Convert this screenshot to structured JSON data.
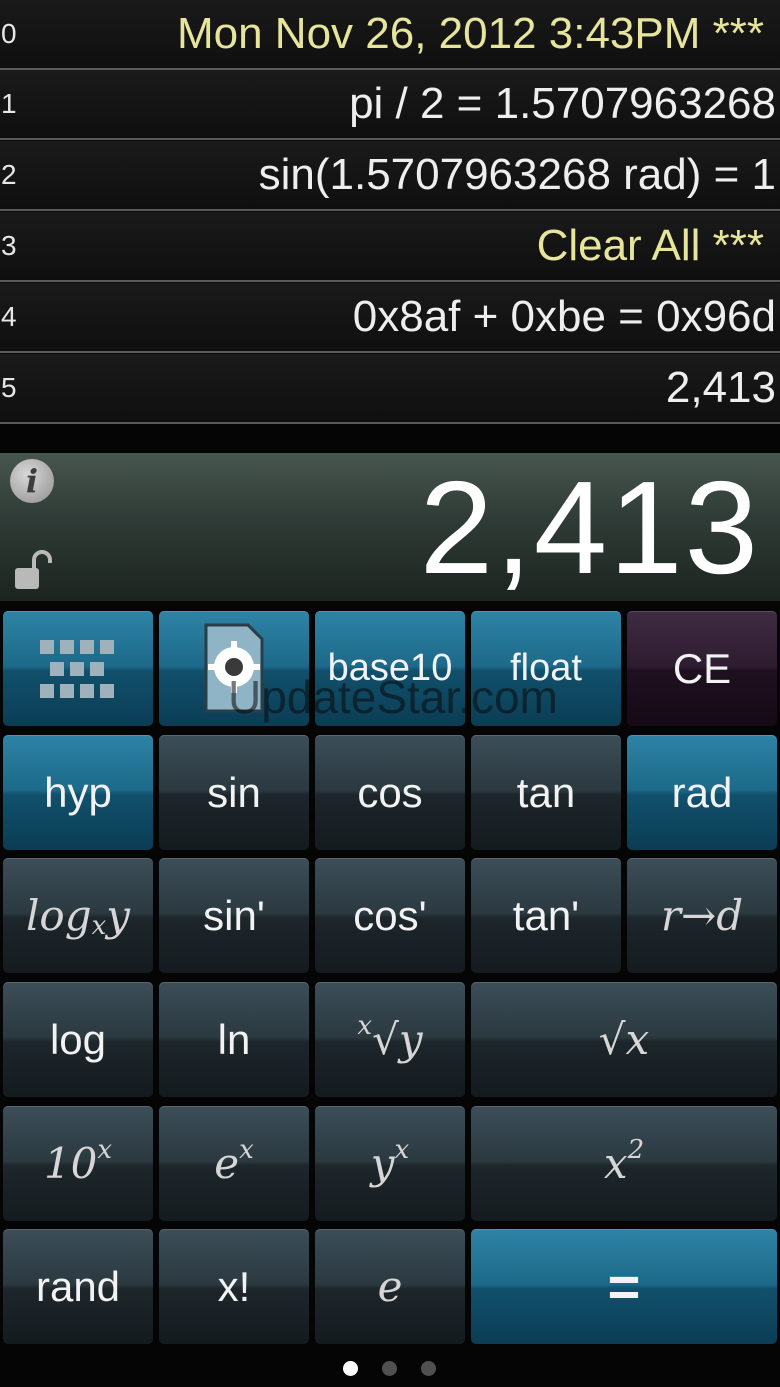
{
  "tape": [
    {
      "index": "0",
      "text": "Mon Nov 26, 2012 3:43PM ***",
      "style": "yellow"
    },
    {
      "index": "1",
      "text": "pi / 2 = 1.5707963268",
      "style": "white"
    },
    {
      "index": "2",
      "text": "sin(1.5707963268 rad) = 1",
      "style": "white"
    },
    {
      "index": "3",
      "text": "Clear All ***",
      "style": "yellow"
    },
    {
      "index": "4",
      "text": "0x8af + 0xbe = 0x96d",
      "style": "white"
    },
    {
      "index": "5",
      "text": "2,413",
      "style": "white"
    }
  ],
  "display": {
    "value": "2,413",
    "info_icon": "info-icon",
    "lock_icon": "unlock-icon"
  },
  "keys": {
    "row1": {
      "grid_icon": "grid-icon",
      "settings_icon": "gear-document-icon",
      "base": "base10",
      "mode": "float",
      "ce": "CE"
    },
    "row2": {
      "hyp": "hyp",
      "sin": "sin",
      "cos": "cos",
      "tan": "tan",
      "rad": "rad"
    },
    "row3": {
      "log_base": "log",
      "log_x": "x",
      "log_y": "y",
      "asin": "sin'",
      "acos": "cos'",
      "atan": "tan'",
      "r2d": "r→d"
    },
    "row4": {
      "log": "log",
      "ln": "ln",
      "root_x": "x",
      "root_y": "y",
      "sqrt": "√x"
    },
    "row5": {
      "ten_base": "10",
      "ten_exp": "x",
      "e_base": "e",
      "e_exp": "x",
      "y_base": "y",
      "y_exp": "x",
      "sq_base": "x",
      "sq_exp": "2"
    },
    "row6": {
      "rand": "rand",
      "fact": "x!",
      "e": "e",
      "equals": "="
    }
  },
  "watermark": "UpdateStar.com",
  "pager": {
    "count": 3,
    "active": 1
  },
  "colors": {
    "tape_yellow": "#e7e49c",
    "blue_key": "#1d6989",
    "ce_key": "#2e1c30",
    "dark_key": "#2b3940"
  }
}
